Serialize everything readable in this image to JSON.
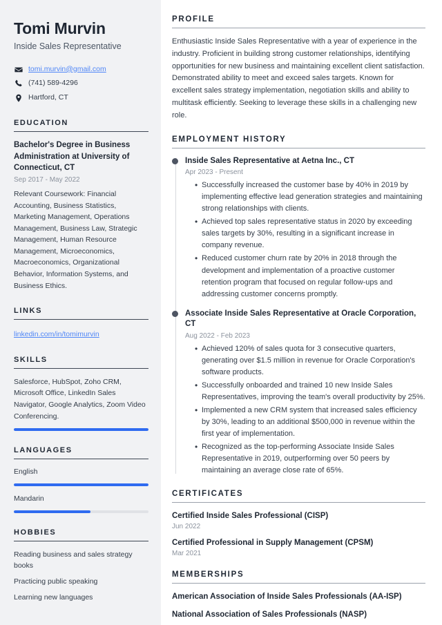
{
  "colors": {
    "accent_blue": "#2f6bf0",
    "link_blue": "#4f86f7",
    "sidebar_bg": "#f1f2f4",
    "heading": "#1f2733",
    "body_text": "#333c48",
    "muted": "#8b929d",
    "timeline_dot": "#4e5563"
  },
  "sidebar": {
    "name": "Tomi Murvin",
    "job_title": "Inside Sales Representative",
    "contacts": [
      {
        "icon": "envelope-icon",
        "text": "tomi.murvin@gmail.com",
        "is_link": true
      },
      {
        "icon": "phone-icon",
        "text": "(741) 589-4296",
        "is_link": false
      },
      {
        "icon": "location-pin-icon",
        "text": "Hartford, CT",
        "is_link": false
      }
    ],
    "education": {
      "heading": "EDUCATION",
      "title": "Bachelor's Degree in Business Administration at University of Connecticut, CT",
      "date": "Sep 2017 - May 2022",
      "description": "Relevant Coursework: Financial Accounting, Business Statistics, Marketing Management, Operations Management, Business Law, Strategic Management, Human Resource Management, Microeconomics, Macroeconomics, Organizational Behavior, Information Systems, and Business Ethics."
    },
    "links": {
      "heading": "LINKS",
      "items": [
        {
          "label": "linkedin.com/in/tomimurvin"
        }
      ]
    },
    "skills": {
      "heading": "SKILLS",
      "text": "Salesforce, HubSpot, Zoho CRM, Microsoft Office, LinkedIn Sales Navigator, Google Analytics, Zoom Video Conferencing.",
      "level_percent": 100
    },
    "languages": {
      "heading": "LANGUAGES",
      "items": [
        {
          "name": "English",
          "level_percent": 100
        },
        {
          "name": "Mandarin",
          "level_percent": 57
        }
      ]
    },
    "hobbies": {
      "heading": "HOBBIES",
      "items": [
        "Reading business and sales strategy books",
        "Practicing public speaking",
        "Learning new languages"
      ]
    }
  },
  "main": {
    "profile": {
      "heading": "PROFILE",
      "text": "Enthusiastic Inside Sales Representative with a year of experience in the industry. Proficient in building strong customer relationships, identifying opportunities for new business and maintaining excellent client satisfaction. Demonstrated ability to meet and exceed sales targets. Known for excellent sales strategy implementation, negotiation skills and ability to multitask efficiently. Seeking to leverage these skills in a challenging new role."
    },
    "employment": {
      "heading": "EMPLOYMENT HISTORY",
      "jobs": [
        {
          "title": "Inside Sales Representative at Aetna Inc., CT",
          "date": "Apr 2023 - Present",
          "bullets": [
            "Successfully increased the customer base by 40% in 2019 by implementing effective lead generation strategies and maintaining strong relationships with clients.",
            "Achieved top sales representative status in 2020 by exceeding sales targets by 30%, resulting in a significant increase in company revenue.",
            "Reduced customer churn rate by 20% in 2018 through the development and implementation of a proactive customer retention program that focused on regular follow-ups and addressing customer concerns promptly."
          ]
        },
        {
          "title": "Associate Inside Sales Representative at Oracle Corporation, CT",
          "date": "Aug 2022 - Feb 2023",
          "bullets": [
            "Achieved 120% of sales quota for 3 consecutive quarters, generating over $1.5 million in revenue for Oracle Corporation's software products.",
            "Successfully onboarded and trained 10 new Inside Sales Representatives, improving the team's overall productivity by 25%.",
            "Implemented a new CRM system that increased sales efficiency by 30%, leading to an additional $500,000 in revenue within the first year of implementation.",
            "Recognized as the top-performing Associate Inside Sales Representative in 2019, outperforming over 50 peers by maintaining an average close rate of 65%."
          ]
        }
      ]
    },
    "certificates": {
      "heading": "CERTIFICATES",
      "items": [
        {
          "name": "Certified Inside Sales Professional (CISP)",
          "date": "Jun 2022"
        },
        {
          "name": "Certified Professional in Supply Management (CPSM)",
          "date": "Mar 2021"
        }
      ]
    },
    "memberships": {
      "heading": "MEMBERSHIPS",
      "items": [
        "American Association of Inside Sales Professionals (AA-ISP)",
        "National Association of Sales Professionals (NASP)"
      ]
    }
  }
}
